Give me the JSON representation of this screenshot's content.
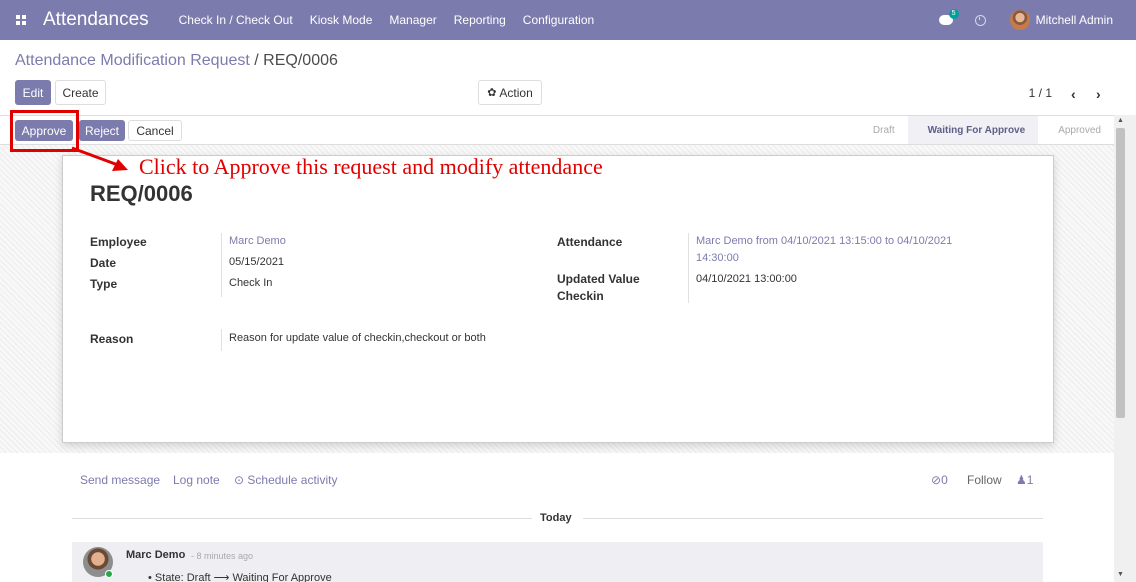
{
  "navbar": {
    "app_title": "Attendances",
    "menu": [
      "Check In / Check Out",
      "Kiosk Mode",
      "Manager",
      "Reporting",
      "Configuration"
    ],
    "chat_badge": "5",
    "user_name": "Mitchell Admin"
  },
  "breadcrumb": {
    "parent": "Attendance Modification Request",
    "separator": "/",
    "current": "REQ/0006"
  },
  "control": {
    "edit_label": "Edit",
    "create_label": "Create",
    "action_label": "Action",
    "pager": "1 / 1"
  },
  "statusbar": {
    "approve_label": "Approve",
    "reject_label": "Reject",
    "cancel_label": "Cancel",
    "stages": [
      "Draft",
      "Waiting For Approve",
      "Approved"
    ],
    "active_stage": "Waiting For Approve"
  },
  "annotation": {
    "text": "Click to Approve this request and modify attendance",
    "color": "#e00000"
  },
  "record": {
    "title": "REQ/0006",
    "employee_label": "Employee",
    "employee_value": "Marc Demo",
    "date_label": "Date",
    "date_value": "05/15/2021",
    "type_label": "Type",
    "type_value": "Check In",
    "attendance_label": "Attendance",
    "attendance_value_line1": "Marc Demo from 04/10/2021 13:15:00 to 04/10/2021",
    "attendance_value_line2": "14:30:00",
    "updated_label_line1": "Updated Value",
    "updated_label_line2": "Checkin",
    "updated_value": "04/10/2021 13:00:00",
    "reason_label": "Reason",
    "reason_value": "Reason for update value of checkin,checkout or both"
  },
  "chatter": {
    "send_message": "Send message",
    "log_note": "Log note",
    "schedule_activity": "Schedule activity",
    "attachments_count": "0",
    "follow_label": "Follow",
    "followers_count": "1",
    "date_separator": "Today",
    "message": {
      "author": "Marc Demo",
      "time": "- 8 minutes ago",
      "body": "State: Draft ⟶ Waiting For Approve"
    }
  },
  "colors": {
    "brand": "#7c7bad",
    "link": "#7c7bad",
    "annotation": "#e00000"
  }
}
